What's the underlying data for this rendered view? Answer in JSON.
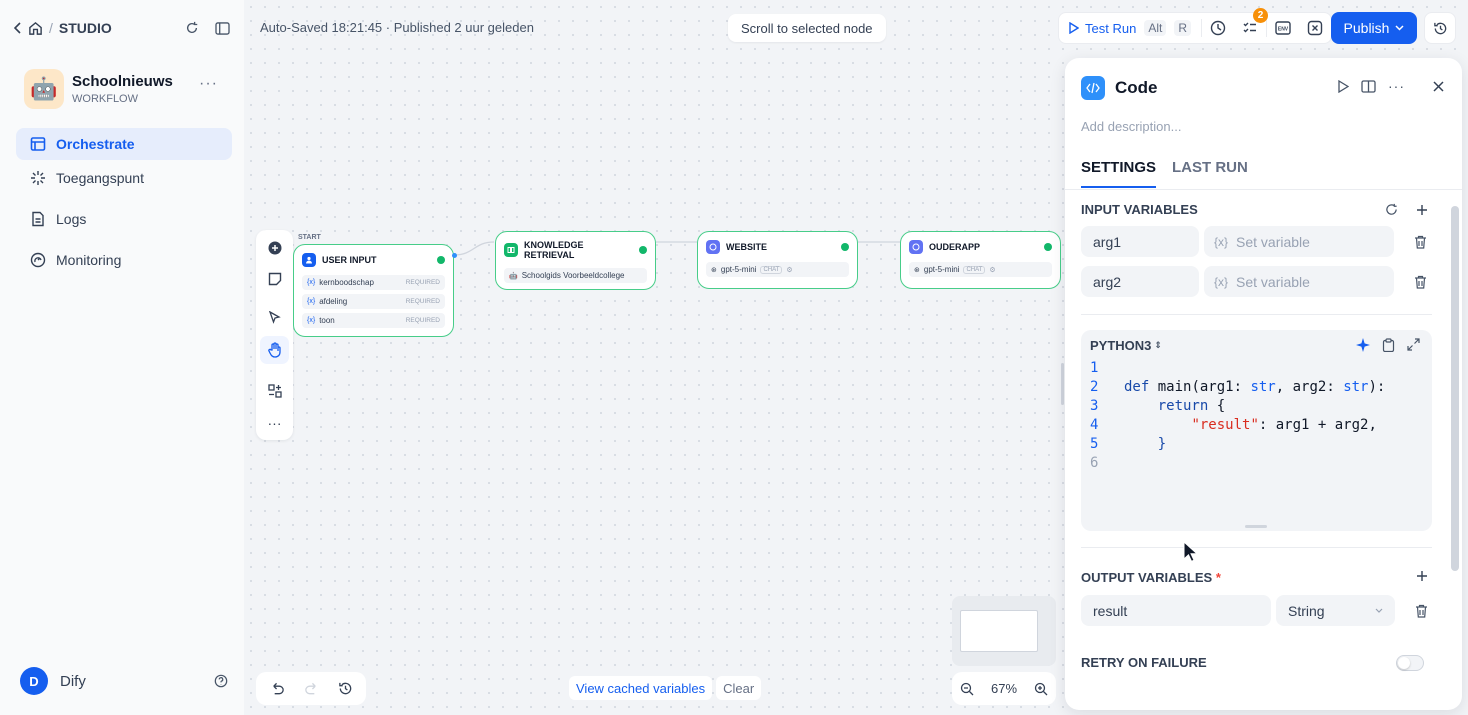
{
  "sidebar": {
    "studio_label": "STUDIO",
    "app": {
      "name": "Schoolnieuws",
      "type": "WORKFLOW"
    },
    "nav": [
      {
        "label": "Orchestrate",
        "icon": "orchestrate-icon",
        "active": true
      },
      {
        "label": "Toegangspunt",
        "icon": "access-point-icon",
        "active": false
      },
      {
        "label": "Logs",
        "icon": "logs-icon",
        "active": false
      },
      {
        "label": "Monitoring",
        "icon": "monitoring-icon",
        "active": false
      }
    ],
    "user": {
      "initial": "D",
      "name": "Dify"
    }
  },
  "topbar": {
    "status": "Auto-Saved 18:21:45 · Published 2 uur geleden",
    "scroll_btn": "Scroll to selected node",
    "test_run": "Test Run",
    "test_run_key1": "Alt",
    "test_run_key2": "R",
    "badge": "2",
    "publish": "Publish"
  },
  "nodes": {
    "start_label": "START",
    "user_input": {
      "title": "USER INPUT",
      "fields": [
        {
          "name": "kernboodschap",
          "req": "REQUIRED"
        },
        {
          "name": "afdeling",
          "req": "REQUIRED"
        },
        {
          "name": "toon",
          "req": "REQUIRED"
        }
      ]
    },
    "knowledge": {
      "title": "KNOWLEDGE RETRIEVAL",
      "item": "Schoolgids Voorbeeldcollege"
    },
    "website": {
      "title": "WEBSITE",
      "model": "gpt-5-mini",
      "chip": "CHAT"
    },
    "ouderapp": {
      "title": "OUDERAPP",
      "model": "gpt-5-mini",
      "chip": "CHAT"
    }
  },
  "canvas_bottom": {
    "view_cached": "View cached variables",
    "clear": "Clear",
    "zoom": "67%"
  },
  "panel": {
    "title": "Code",
    "description_placeholder": "Add description...",
    "tabs": [
      "SETTINGS",
      "LAST RUN"
    ],
    "input_title": "INPUT VARIABLES",
    "inputs": [
      {
        "name": "arg1",
        "placeholder": "Set variable"
      },
      {
        "name": "arg2",
        "placeholder": "Set variable"
      }
    ],
    "var_symbol": "{x}",
    "language": "PYTHON3",
    "code_lines": [
      {
        "n": "1",
        "t": ""
      },
      {
        "n": "2",
        "t": "def main(arg1: str, arg2: str):"
      },
      {
        "n": "3",
        "t": "    return {"
      },
      {
        "n": "4",
        "t": "        \"result\": arg1 + arg2,"
      },
      {
        "n": "5",
        "t": "    }"
      },
      {
        "n": "6",
        "t": ""
      }
    ],
    "output_title": "OUTPUT VARIABLES",
    "output": {
      "name": "result",
      "type": "String"
    },
    "retry_title": "RETRY ON FAILURE",
    "retry_enabled": false
  },
  "colors": {
    "accent": "#155eef",
    "node_border": "#47cd89",
    "success": "#12b76a"
  }
}
